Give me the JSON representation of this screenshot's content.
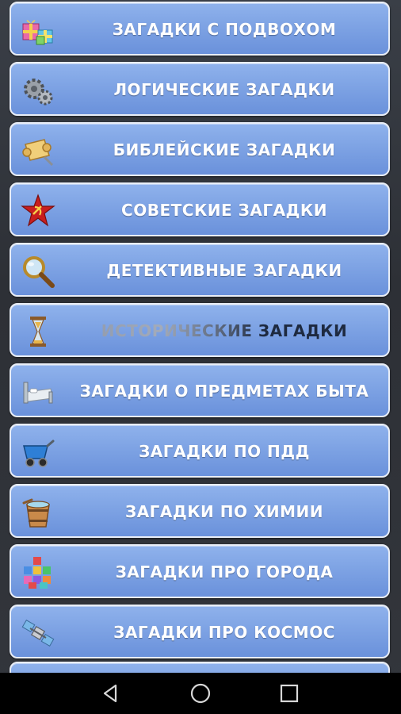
{
  "menu": {
    "items": [
      {
        "label": "ЗАГАДКИ С ПОДВОХОМ",
        "icon": "gift-boxes-icon"
      },
      {
        "label": "ЛОГИЧЕСКИЕ ЗАГАДКИ",
        "icon": "gears-icon"
      },
      {
        "label": "БИБЛЕЙСКИЕ ЗАГАДКИ",
        "icon": "scroll-icon"
      },
      {
        "label": "СОВЕТСКИЕ ЗАГАДКИ",
        "icon": "soviet-star-icon"
      },
      {
        "label": "ДЕТЕКТИВНЫЕ ЗАГАДКИ",
        "icon": "magnifier-icon"
      },
      {
        "label": "ИСТОРИЧЕСКИЕ ЗАГАДКИ",
        "icon": "hourglass-icon"
      },
      {
        "label": "ЗАГАДКИ О ПРЕДМЕТАХ БЫТА",
        "icon": "bed-icon"
      },
      {
        "label": "ЗАГАДКИ ПО ПДД",
        "icon": "cart-icon"
      },
      {
        "label": "ЗАГАДКИ ПО ХИМИИ",
        "icon": "bucket-icon"
      },
      {
        "label": "ЗАГАДКИ ПРО ГОРОДА",
        "icon": "city-blocks-icon"
      },
      {
        "label": "ЗАГАДКИ ПРО КОСМОС",
        "icon": "satellite-icon"
      },
      {
        "label": "",
        "icon": "next-item-icon"
      }
    ]
  },
  "navbar": {
    "back": "back-triangle-icon",
    "home": "home-circle-icon",
    "recents": "recents-square-icon"
  },
  "colors": {
    "button_top": "#8fb2ec",
    "button_bottom": "#6a91db",
    "button_border": "#e9eef7",
    "label_text": "#ffffff",
    "navbar_bg": "#000000"
  }
}
